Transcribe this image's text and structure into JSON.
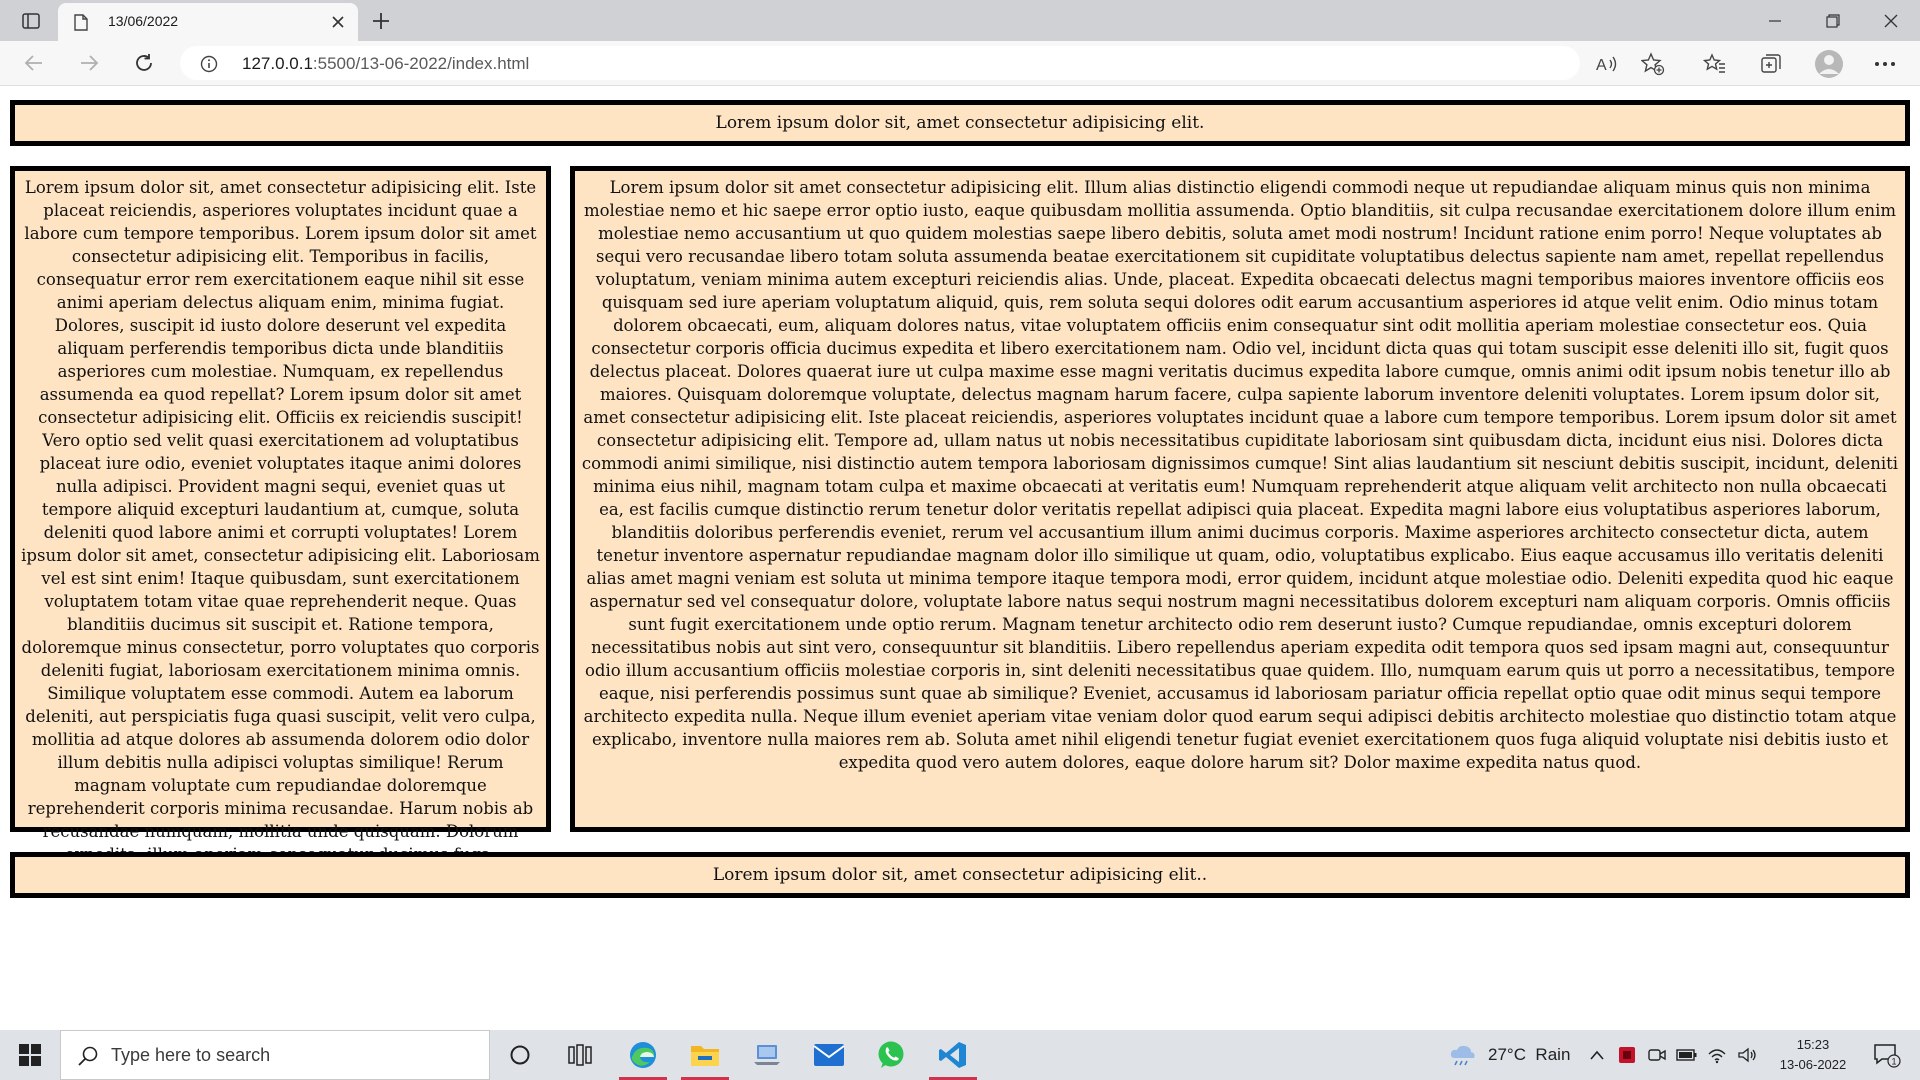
{
  "browser": {
    "tab_title": "13/06/2022",
    "url_host": "127.0.0.1",
    "url_rest": ":5500/13-06-2022/index.html"
  },
  "page": {
    "header_text": "Lorem ipsum dolor sit, amet consectetur adipisicing elit.",
    "left_text": "Lorem ipsum dolor sit, amet consectetur adipisicing elit. Iste placeat reiciendis, asperiores voluptates incidunt quae a labore cum tempore temporibus. Lorem ipsum dolor sit amet consectetur adipisicing elit. Temporibus in facilis, consequatur error rem exercitationem eaque nihil sit esse animi aperiam delectus aliquam enim, minima fugiat. Dolores, suscipit id iusto dolore deserunt vel expedita aliquam perferendis temporibus dicta unde blanditiis asperiores cum molestiae. Numquam, ex repellendus assumenda ea quod repellat? Lorem ipsum dolor sit amet consectetur adipisicing elit. Officiis ex reiciendis suscipit! Vero optio sed velit quasi exercitationem ad voluptatibus placeat iure odio, eveniet voluptates itaque animi dolores nulla adipisci. Provident magni sequi, eveniet quas ut tempore aliquid excepturi laudantium at, cumque, soluta deleniti quod labore animi et corrupti voluptates! Lorem ipsum dolor sit amet, consectetur adipisicing elit. Laboriosam vel est sint enim! Itaque quibusdam, sunt exercitationem voluptatem totam vitae quae reprehenderit neque. Quas blanditiis ducimus sit suscipit et. Ratione tempora, doloremque minus consectetur, porro voluptates quo corporis deleniti fugiat, laboriosam exercitationem minima omnis. Similique voluptatem esse commodi. Autem ea laborum deleniti, aut perspiciatis fuga quasi suscipit, velit vero culpa, mollitia ad atque dolores ab assumenda dolorem odio dolor illum debitis nulla adipisci voluptas similique! Rerum magnam voluptate cum repudiandae doloremque reprehenderit corporis minima recusandae. Harum nobis ab recusandae numquam, mollitia unde quisquam. Dolorum expedita, illum aperiam consequatur ducimus fuga.",
    "right_text": "Lorem ipsum dolor sit amet consectetur adipisicing elit. Illum alias distinctio eligendi commodi neque ut repudiandae aliquam minus quis non minima molestiae nemo et hic saepe error optio iusto, eaque quibusdam mollitia assumenda. Optio blanditiis, sit culpa recusandae exercitationem dolore illum enim molestiae nemo accusantium ut quo quidem molestias saepe libero debitis, soluta amet modi nostrum! Incidunt ratione enim porro! Neque voluptates ab sequi vero recusandae libero totam soluta assumenda beatae exercitationem sit cupiditate voluptatibus delectus sapiente nam amet, repellat repellendus voluptatum, veniam minima autem excepturi reiciendis alias. Unde, placeat. Expedita obcaecati delectus magni temporibus maiores inventore officiis eos quisquam sed iure aperiam voluptatum aliquid, quis, rem soluta sequi dolores odit earum accusantium asperiores id atque velit enim. Odio minus totam dolorem obcaecati, eum, aliquam dolores natus, vitae voluptatem officiis enim consequatur sint odit mollitia aperiam molestiae consectetur eos. Quia consectetur corporis officia ducimus expedita et libero exercitationem nam. Odio vel, incidunt dicta quas qui totam suscipit esse deleniti illo sit, fugit quos delectus placeat. Dolores quaerat iure ut culpa maxime esse magni veritatis ducimus expedita labore cumque, omnis animi odit ipsum nobis tenetur illo ab maiores. Quisquam doloremque voluptate, delectus magnam harum facere, culpa sapiente laborum inventore deleniti voluptates. Lorem ipsum dolor sit, amet consectetur adipisicing elit. Iste placeat reiciendis, asperiores voluptates incidunt quae a labore cum tempore temporibus. Lorem ipsum dolor sit amet consectetur adipisicing elit. Tempore ad, ullam natus ut nobis necessitatibus cupiditate laboriosam sint quibusdam dicta, incidunt eius nisi. Dolores dicta commodi animi similique, nisi distinctio autem tempora laboriosam dignissimos cumque! Sint alias laudantium sit nesciunt debitis suscipit, incidunt, deleniti minima eius nihil, magnam totam culpa et maxime obcaecati at veritatis eum! Numquam reprehenderit atque aliquam velit architecto non nulla obcaecati ea, est facilis cumque distinctio rerum tenetur dolor veritatis repellat adipisci quia placeat. Expedita magni labore eius voluptatibus asperiores laborum, blanditiis doloribus perferendis eveniet, rerum vel accusantium illum animi ducimus corporis. Maxime asperiores architecto consectetur dicta, autem tenetur inventore aspernatur repudiandae magnam dolor illo similique ut quam, odio, voluptatibus explicabo. Eius eaque accusamus illo veritatis deleniti alias amet magni veniam est soluta ut minima tempore itaque tempora modi, error quidem, incidunt atque molestiae odio. Deleniti expedita quod hic eaque aspernatur sed vel consequatur dolore, voluptate labore natus sequi nostrum magni necessitatibus dolorem excepturi nam aliquam corporis. Omnis officiis sunt fugit exercitationem unde optio rerum. Magnam tenetur architecto odio rem deserunt iusto? Cumque repudiandae, omnis excepturi dolorem necessitatibus nobis aut sint vero, consequuntur sit blanditiis. Libero repellendus aperiam expedita odit tempora quos sed ipsam magni aut, consequuntur odio illum accusantium officiis molestiae corporis in, sint deleniti necessitatibus quae quidem. Illo, numquam earum quis ut porro a necessitatibus, tempore eaque, nisi perferendis possimus sunt quae ab similique? Eveniet, accusamus id laboriosam pariatur officia repellat optio quae odit minus sequi tempore architecto expedita nulla. Neque illum eveniet aperiam vitae veniam dolor quod earum sequi adipisci debitis architecto molestiae quo distinctio totam atque explicabo, inventore nulla maiores rem ab. Soluta amet nihil eligendi tenetur fugiat eveniet exercitationem quos fuga aliquid voluptate nisi debitis iusto et expedita quod vero autem dolores, eaque dolore harum sit? Dolor maxime expedita natus quod.",
    "footer_text": "Lorem ipsum dolor sit, amet consectetur adipisicing elit.."
  },
  "taskbar": {
    "search_placeholder": "Type here to search",
    "weather": "27°C  Rain",
    "time": "15:23",
    "date": "13-06-2022",
    "notification_count": "1"
  },
  "colors": {
    "box_background": "#ffe4c4",
    "box_border": "#000000"
  }
}
